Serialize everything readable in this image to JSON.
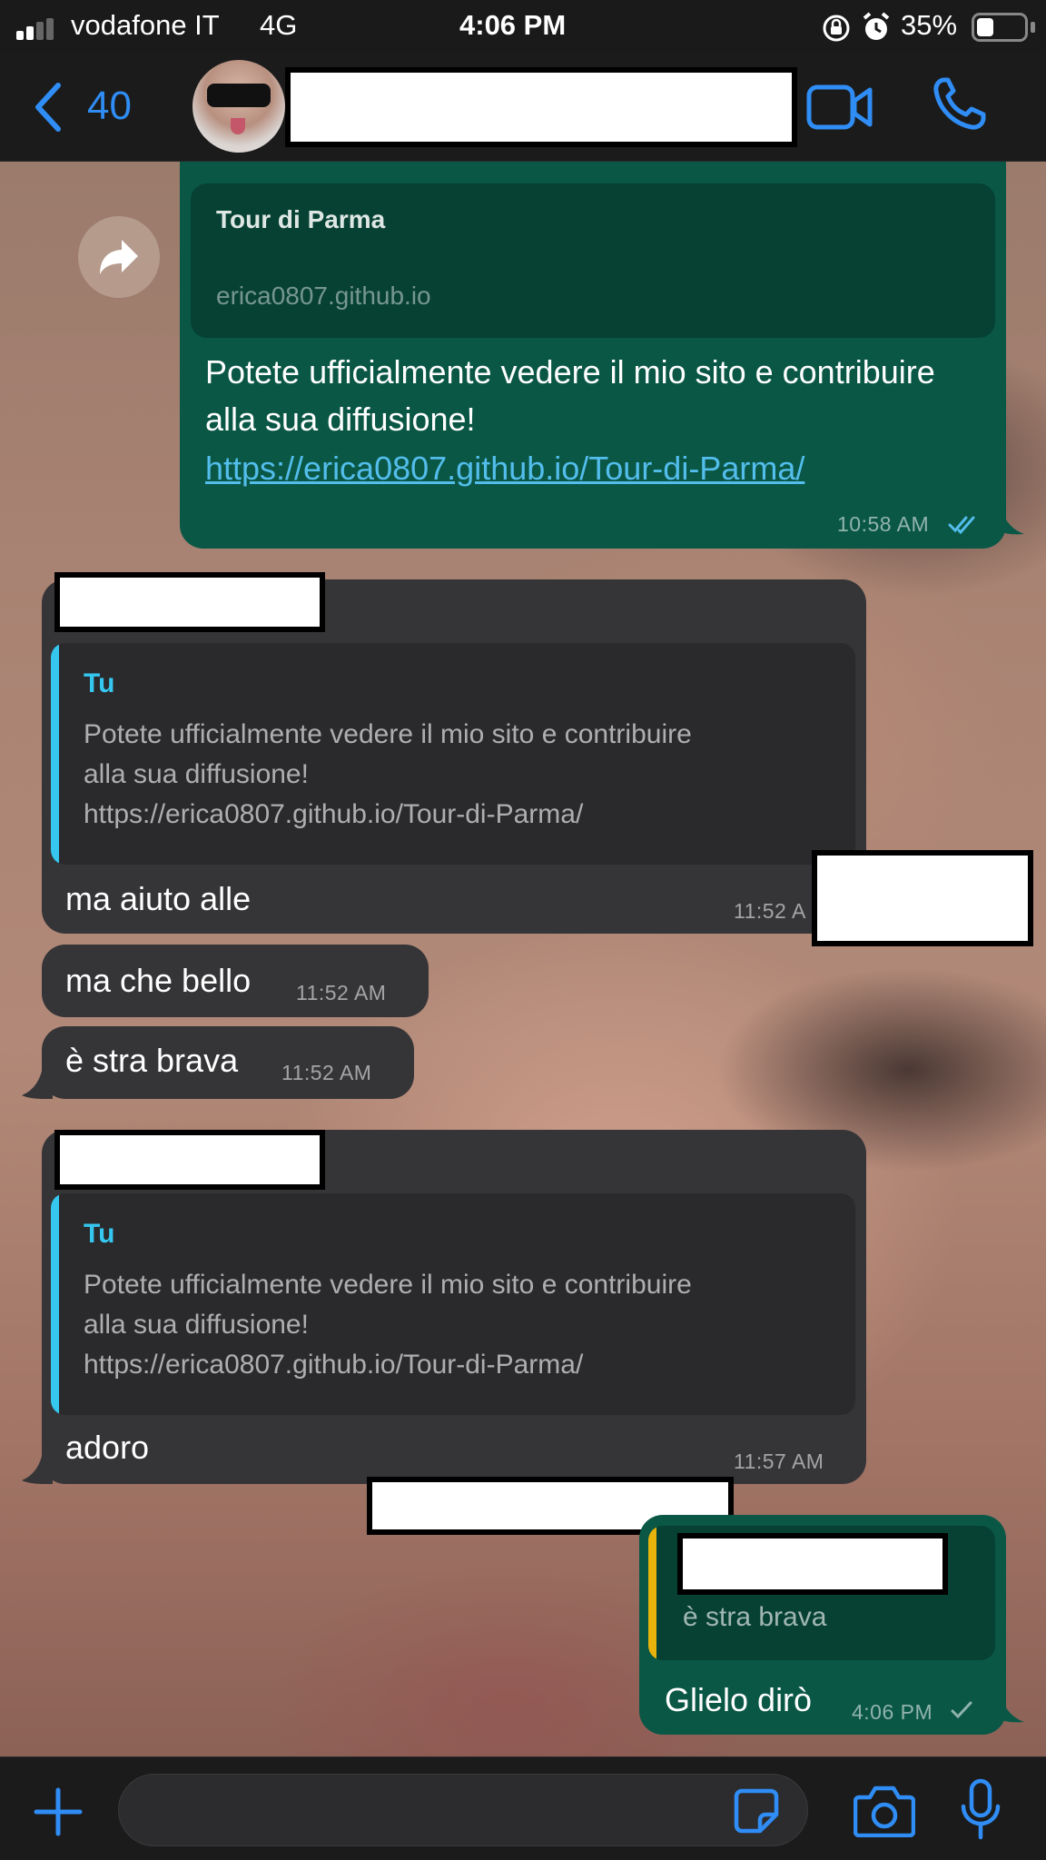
{
  "status": {
    "carrier": "vodafone IT",
    "network": "4G",
    "time": "4:06 PM",
    "battery": "35%",
    "battery_level": 0.35
  },
  "header": {
    "back_count": "40",
    "icons": [
      "chevron-left-icon",
      "video-camera-icon",
      "phone-icon"
    ]
  },
  "messages": {
    "m1": {
      "preview_title": "Tour di Parma",
      "preview_domain": "erica0807.github.io",
      "text": "Potete ufficialmente vedere il mio sito e contribuire alla sua diffusione!",
      "link": "https://erica0807.github.io/Tour-di-Parma/",
      "time": "10:58 AM"
    },
    "m2": {
      "quote_author": "Tu",
      "quote_text_1": "Potete ufficialmente vedere il mio sito e contribuire",
      "quote_text_2": "alla sua diffusione!",
      "quote_text_3": "https://erica0807.github.io/Tour-di-Parma/",
      "text": "ma aiuto alle",
      "time": "11:52 A"
    },
    "m3": {
      "text": "ma che bello",
      "time": "11:52 AM"
    },
    "m4": {
      "text": "è stra brava",
      "time": "11:52 AM"
    },
    "m5": {
      "quote_author": "Tu",
      "quote_text_1": "Potete ufficialmente vedere il mio sito e contribuire",
      "quote_text_2": "alla sua diffusione!",
      "quote_text_3": "https://erica0807.github.io/Tour-di-Parma/",
      "text": "adoro",
      "time": "11:57 AM"
    },
    "m6": {
      "quote_text": "è stra brava",
      "text": "Glielo dirò",
      "time": "4:06 PM"
    }
  },
  "composer": {
    "icons": [
      "plus-icon",
      "sticker-icon",
      "camera-icon",
      "microphone-icon"
    ]
  },
  "colors": {
    "outgoing_bubble": "#0a5746",
    "incoming_bubble": "#353538",
    "accent_blue": "#2f8df5",
    "quote_bar_blue": "#35c7f0",
    "quote_bar_yellow": "#e8b40c",
    "link": "#53bdeb"
  }
}
